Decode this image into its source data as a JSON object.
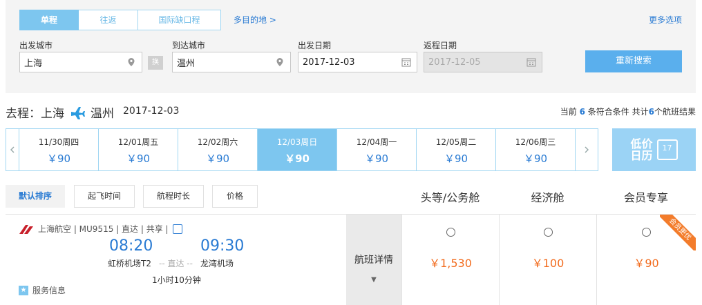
{
  "search": {
    "trip_tabs": [
      "单程",
      "往返",
      "国际缺口程"
    ],
    "multi_link": "多目的地 >",
    "more_options": "更多选项",
    "from_label": "出发城市",
    "from_value": "上海",
    "swap_label": "换",
    "to_label": "到达城市",
    "to_value": "温州",
    "depart_label": "出发日期",
    "depart_value": "2017-12-03",
    "return_label": "返程日期",
    "return_value": "2017-12-05",
    "search_button": "重新搜索"
  },
  "route": {
    "prefix": "去程：",
    "from": "上海",
    "to": "温州",
    "date": "2017-12-03",
    "count_prefix": "当前",
    "matching": "6",
    "count_middle": "条符合条件 共计",
    "total": "6",
    "count_suffix": "个航班结果"
  },
  "date_strip": [
    {
      "date": "11/30周四",
      "price": "￥90"
    },
    {
      "date": "12/01周五",
      "price": "￥90"
    },
    {
      "date": "12/02周六",
      "price": "￥90"
    },
    {
      "date": "12/03周日",
      "price": "￥90"
    },
    {
      "date": "12/04周一",
      "price": "￥90"
    },
    {
      "date": "12/05周二",
      "price": "￥90"
    },
    {
      "date": "12/06周三",
      "price": "￥90"
    }
  ],
  "low_price_calendar": {
    "label": "低价日历",
    "day": "17"
  },
  "sort": [
    "默认排序",
    "起飞时间",
    "航程时长",
    "价格"
  ],
  "cabins": [
    "头等/公务舱",
    "经济舱",
    "会员专享"
  ],
  "flight": {
    "info": "上海航空 | MU9515 | 直达 | 共享 |",
    "dep_time": "08:20",
    "arr_time": "09:30",
    "dep_airport": "虹桥机场T2",
    "via": "-- 直达 --",
    "arr_airport": "龙湾机场",
    "duration": "1小时10分钟",
    "service": "服务信息",
    "details": "航班详情",
    "prices": [
      "￥1,530",
      "￥100",
      "￥90"
    ],
    "ribbon": "会员更优"
  },
  "colors": {
    "accent": "#7dc6ef",
    "link": "#2a7bd3",
    "price": "#f26b1d",
    "button": "#5aafed"
  }
}
